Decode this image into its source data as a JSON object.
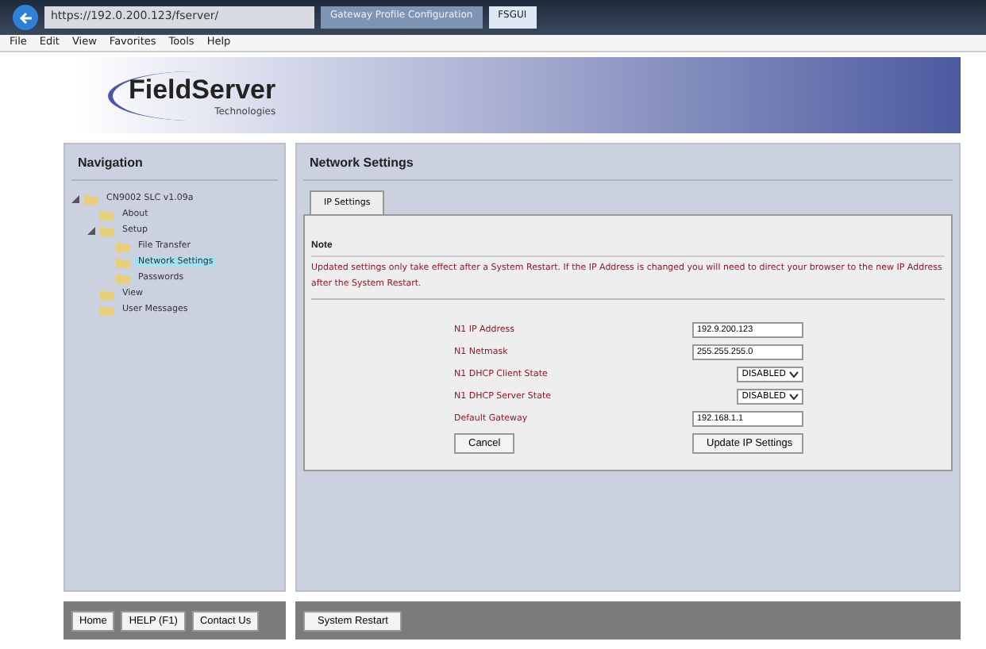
{
  "browser": {
    "address": "https://192.0.200.123/fserver/",
    "tabs": [
      {
        "label": "Gateway Profile Configuration",
        "selected": false
      },
      {
        "label": "FSGUI",
        "selected": true
      }
    ],
    "menu": [
      "File",
      "Edit",
      "View",
      "Favorites",
      "Tools",
      "Help"
    ]
  },
  "header": {
    "logo": "FieldServer",
    "tagline": "Technologies"
  },
  "navigation": {
    "title": "Navigation",
    "tree": [
      {
        "label": "CN9002 SLC v1.09a",
        "expanded": true,
        "selected": false,
        "children": [
          {
            "label": "About",
            "selected": false
          },
          {
            "label": "Setup",
            "expanded": true,
            "selected": false,
            "children": [
              {
                "label": "File Transfer",
                "selected": false
              },
              {
                "label": "Network Settings",
                "selected": true
              },
              {
                "label": "Passwords",
                "selected": false
              }
            ]
          },
          {
            "label": "View",
            "selected": false
          },
          {
            "label": "User Messages",
            "selected": false
          }
        ]
      }
    ],
    "buttons": [
      "Home",
      "HELP (F1)",
      "Contact Us"
    ]
  },
  "main": {
    "title": "Network Settings",
    "tabs": [
      {
        "label": "IP Settings",
        "selected": true
      }
    ],
    "note_title": "Note",
    "note": "Updated settings only take effect after a System Restart. If the IP Address is changed you will need to direct your browser to the new IP Address after the System Restart.",
    "fields": [
      {
        "kind": "input",
        "label": "N1 IP Address",
        "value": "192.9.200.123"
      },
      {
        "kind": "input",
        "label": "N1 Netmask",
        "value": "255.255.255.0"
      },
      {
        "kind": "select",
        "label": "N1 DHCP Client State",
        "value": "DISABLED"
      },
      {
        "kind": "select",
        "label": "N1 DHCP Server State",
        "value": "DISABLED"
      },
      {
        "kind": "input",
        "label": "Default Gateway",
        "value": "192.168.1.1"
      }
    ],
    "cancel": "Cancel",
    "update": "Update IP Settings",
    "footer_button": "System Restart"
  }
}
